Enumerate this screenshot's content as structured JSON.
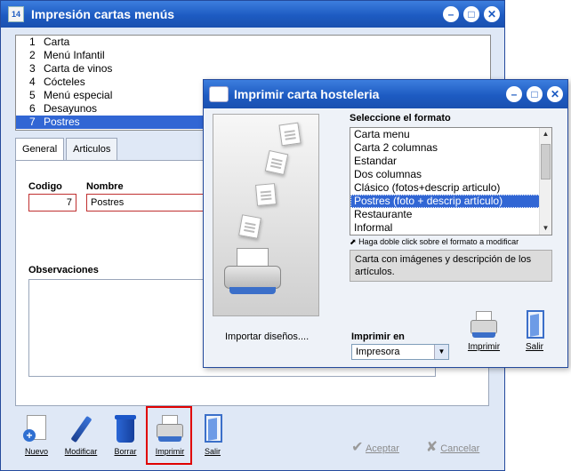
{
  "main_window": {
    "title": "Impresión cartas menús",
    "list": [
      {
        "num": "1",
        "label": "Carta"
      },
      {
        "num": "2",
        "label": "Menú Infantil"
      },
      {
        "num": "3",
        "label": "Carta de vinos"
      },
      {
        "num": "4",
        "label": "Cócteles"
      },
      {
        "num": "5",
        "label": "Menú especial"
      },
      {
        "num": "6",
        "label": "Desayunos"
      },
      {
        "num": "7",
        "label": "Postres"
      }
    ],
    "tabs": [
      "General",
      "Articulos"
    ],
    "codigo_label": "Codigo",
    "codigo_value": "7",
    "nombre_label": "Nombre",
    "nombre_value": "Postres",
    "observaciones_label": "Observaciones",
    "toolbar": {
      "nuevo": "Nuevo",
      "modificar": "Modificar",
      "borrar": "Borrar",
      "imprimir": "Imprimir",
      "salir": "Salir",
      "aceptar": "Aceptar",
      "cancelar": "Cancelar"
    }
  },
  "dialog": {
    "title": "Imprimir carta hosteleria",
    "select_format_label": "Seleccione el formato",
    "formats": [
      "Carta menu",
      "Carta 2 columnas",
      "Estandar",
      "Dos columnas",
      "Clásico (fotos+descrip articulo)",
      "Postres (foto + descrip artículo)",
      "Restaurante",
      "Informal"
    ],
    "selected_format": "Postres (foto + descrip artículo)",
    "hint": "Haga doble click sobre el formato a modificar",
    "description": "Carta con imágenes y descripción de los artículos.",
    "import_label": "Importar diseños....",
    "print_to_label": "Imprimir en",
    "print_to_value": "Impresora",
    "imprimir": "Imprimir",
    "salir": "Salir"
  },
  "colors": {
    "title_bar": "#1d5bc2",
    "selection": "#3166d4",
    "highlight_box": "#e00000"
  }
}
